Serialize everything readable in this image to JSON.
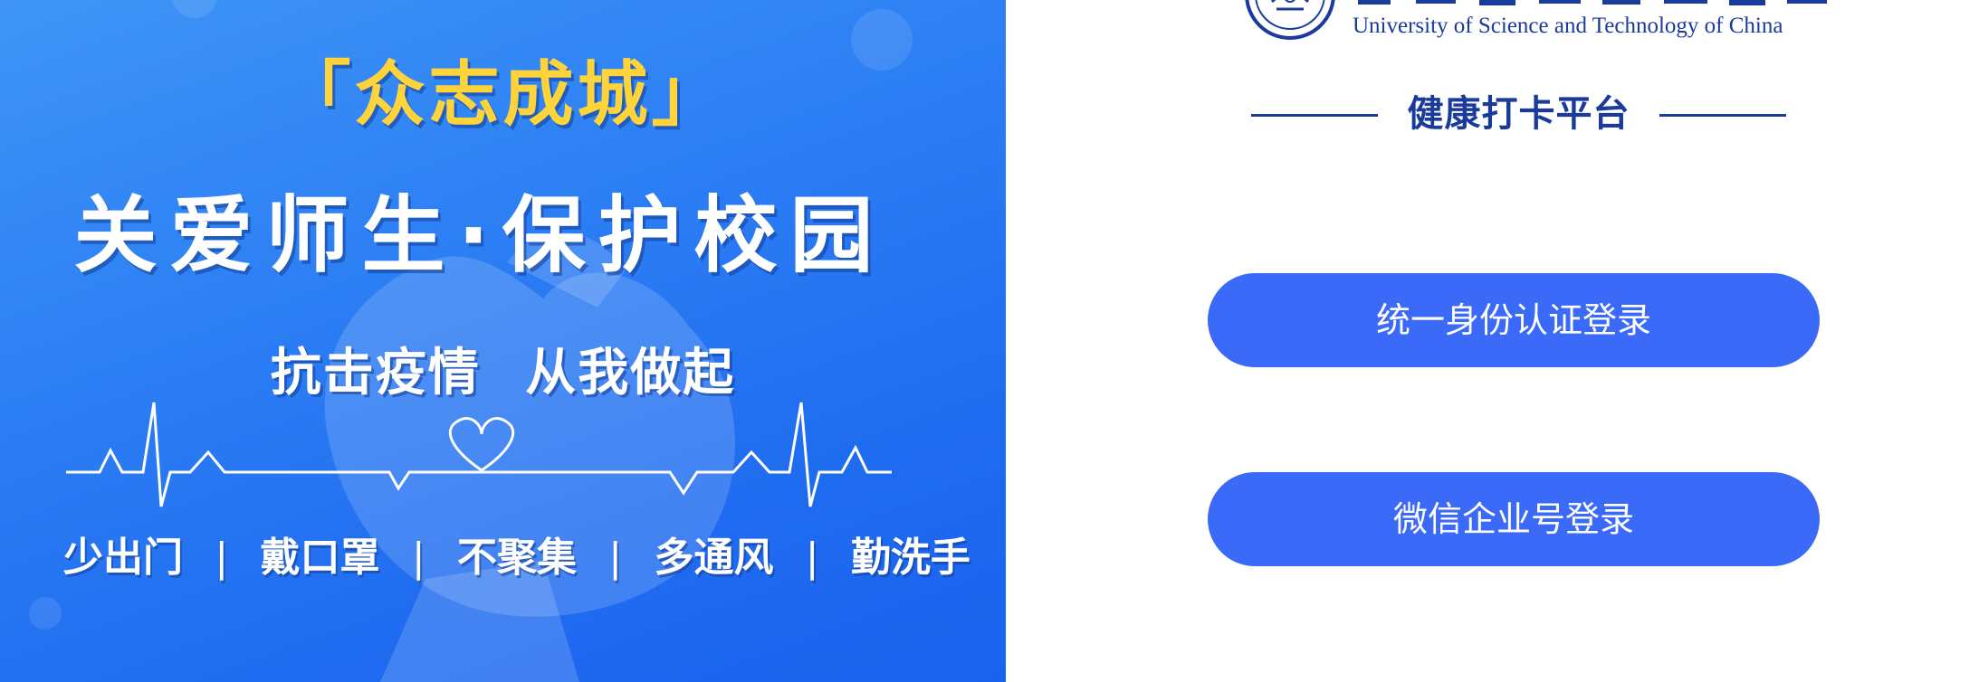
{
  "banner": {
    "slogan_top": "「众志成城」",
    "slogan_main": "关爱师生·保护校园",
    "slogan_sub": "抗击疫情 从我做起",
    "tips": [
      "少出门",
      "戴口罩",
      "不聚集",
      "多通风",
      "勤洗手"
    ],
    "tip_separator": "|"
  },
  "header": {
    "university_en": "University of Science and Technology of China",
    "platform_title": "健康打卡平台"
  },
  "login": {
    "sso_label": "统一身份认证登录",
    "wechat_label": "微信企业号登录"
  },
  "colors": {
    "banner_blue": "#2c7ef4",
    "slogan_yellow": "#ffd33a",
    "title_navy": "#1a3b9c",
    "button_blue": "#3c6af8"
  }
}
